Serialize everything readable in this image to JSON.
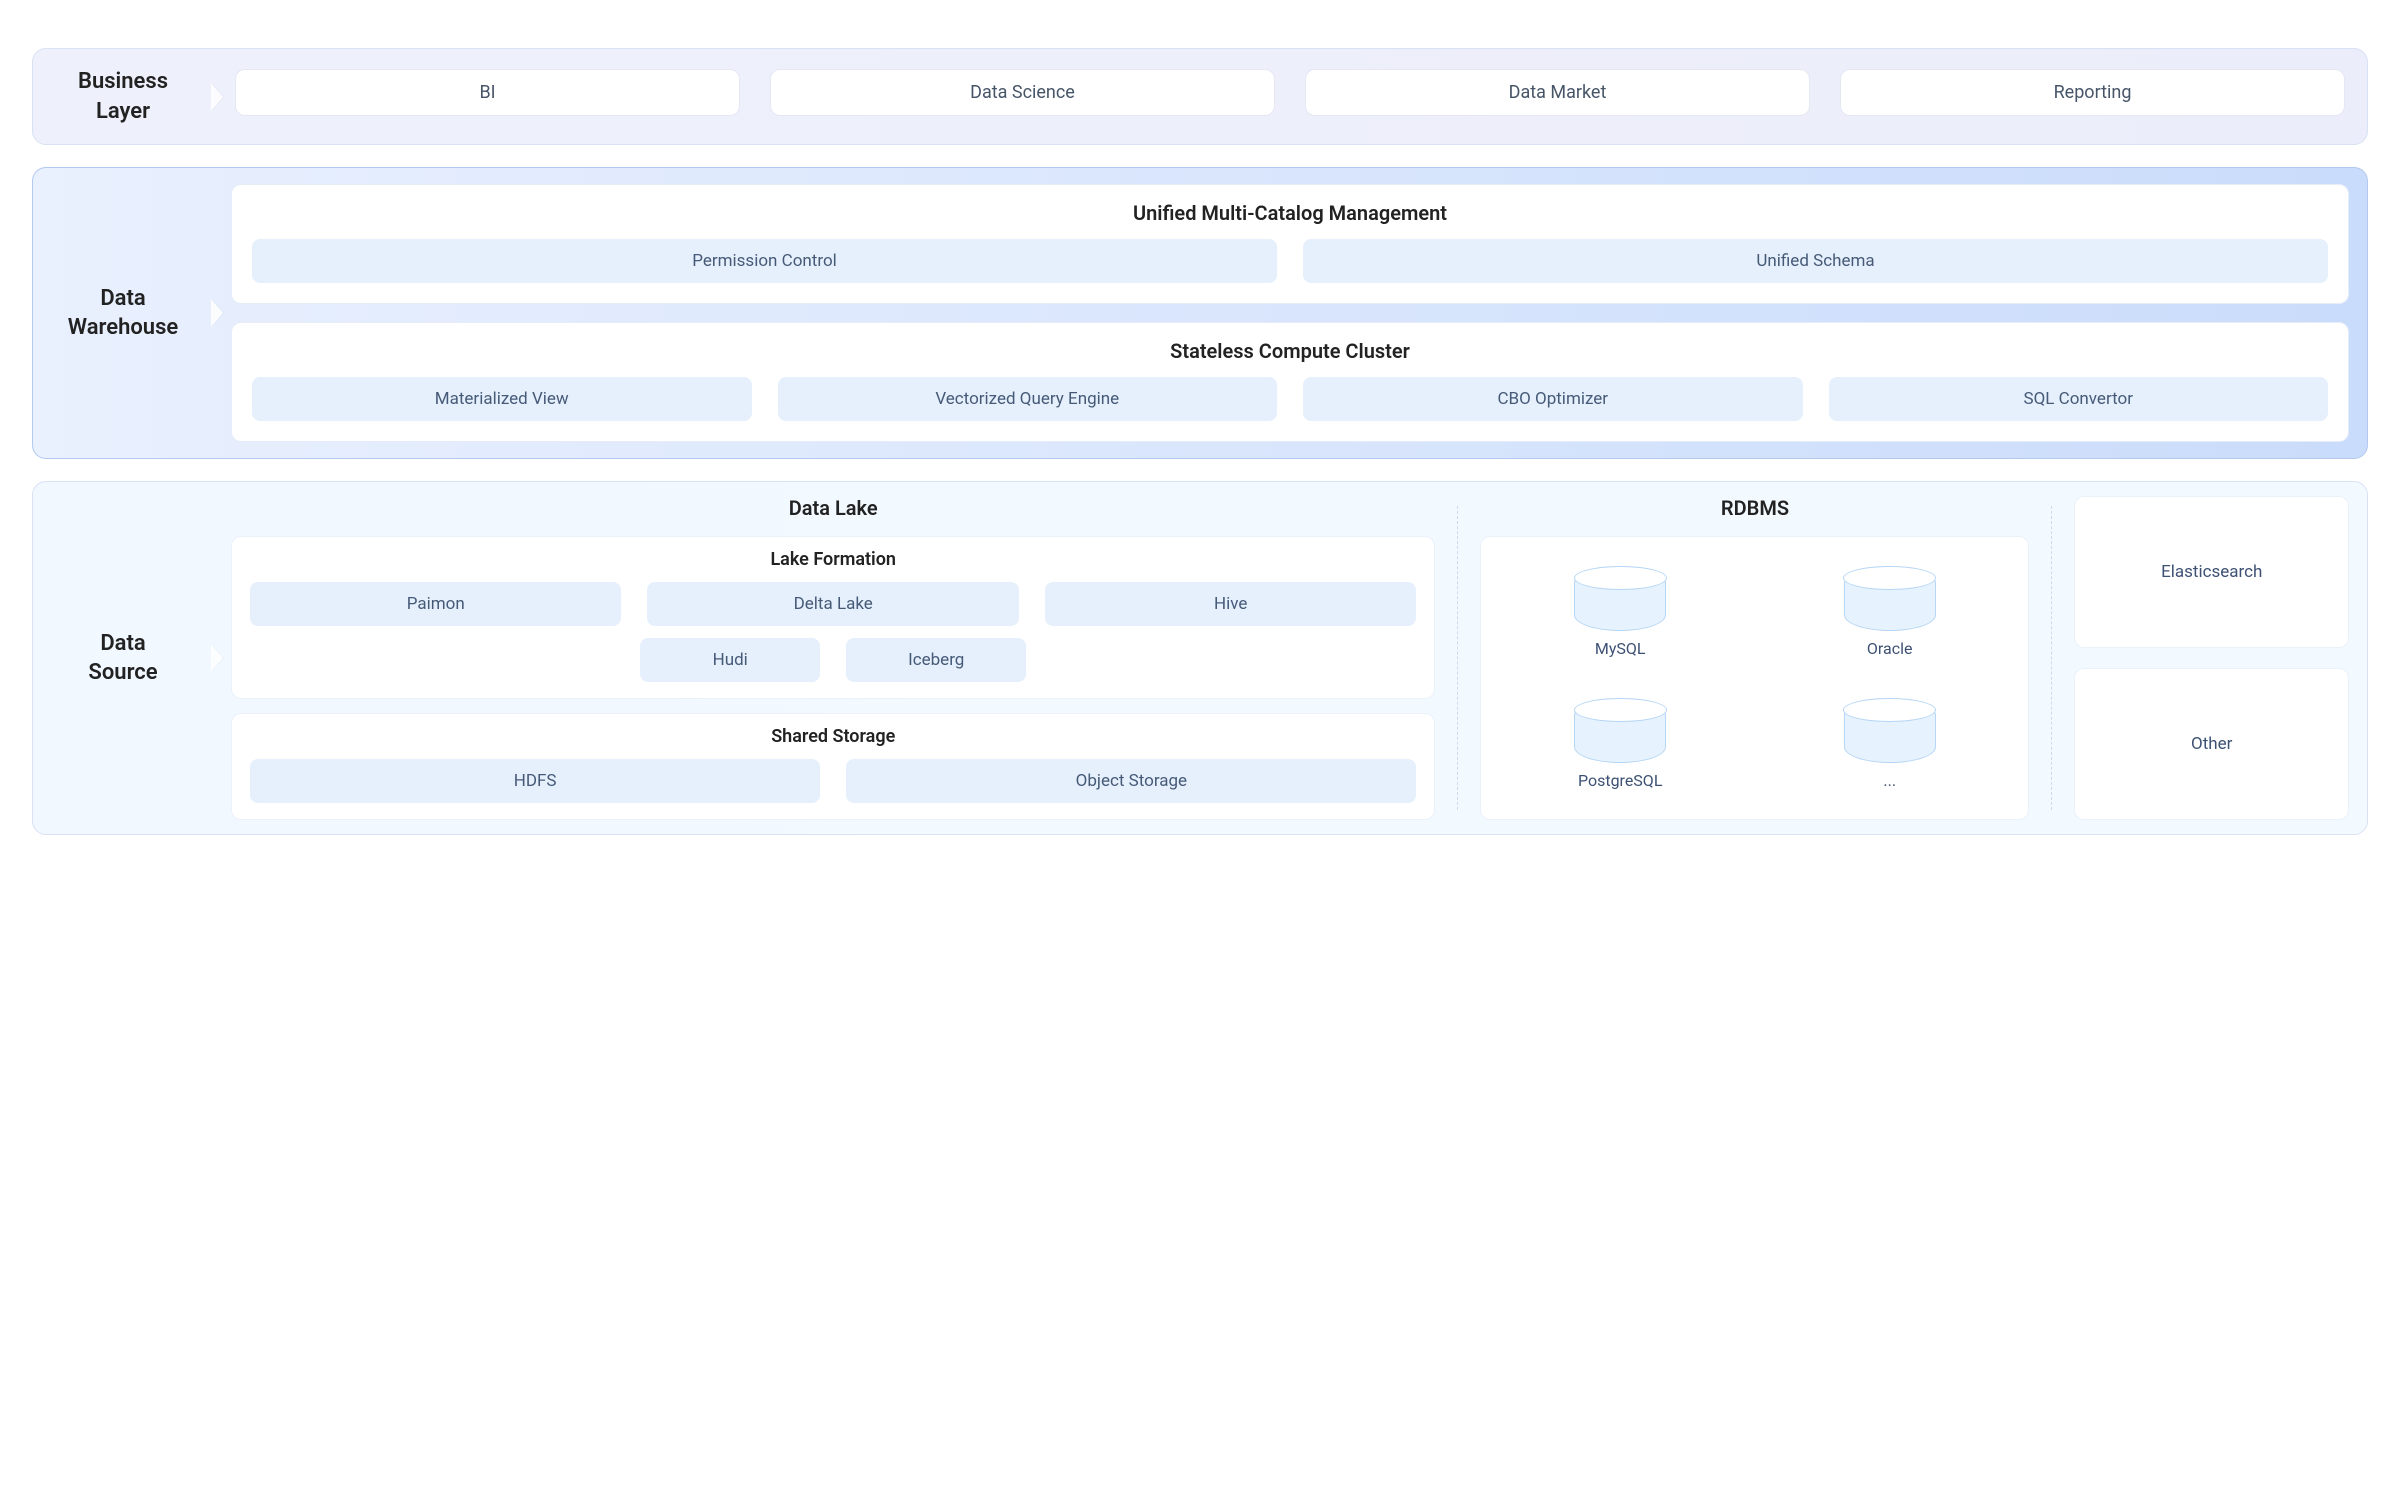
{
  "business_layer": {
    "label": "Business\nLayer",
    "items": [
      "BI",
      "Data Science",
      "Data Market",
      "Reporting"
    ]
  },
  "data_warehouse": {
    "label": "Data\nWarehouse",
    "catalog": {
      "title": "Unified Multi-Catalog Management",
      "items": [
        "Permission Control",
        "Unified Schema"
      ]
    },
    "compute": {
      "title": "Stateless Compute Cluster",
      "items": [
        "Materialized View",
        "Vectorized Query Engine",
        "CBO Optimizer",
        "SQL Convertor"
      ]
    }
  },
  "data_source": {
    "label": "Data\nSource",
    "data_lake": {
      "title": "Data Lake",
      "lake_formation": {
        "title": "Lake Formation",
        "row1": [
          "Paimon",
          "Delta Lake",
          "Hive"
        ],
        "row2": [
          "Hudi",
          "Iceberg"
        ]
      },
      "shared_storage": {
        "title": "Shared Storage",
        "items": [
          "HDFS",
          "Object Storage"
        ]
      }
    },
    "rdbms": {
      "title": "RDBMS",
      "items": [
        "MySQL",
        "Oracle",
        "PostgreSQL",
        "..."
      ]
    },
    "side": {
      "items": [
        "Elasticsearch",
        "Other"
      ]
    }
  }
}
